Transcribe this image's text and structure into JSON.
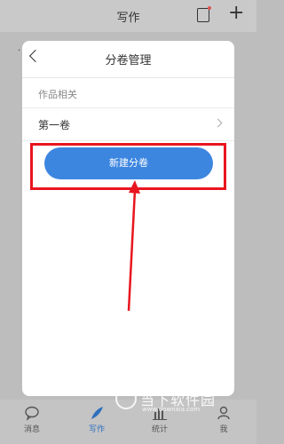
{
  "app": {
    "title": "写作"
  },
  "tabs": [
    {
      "label": "消息",
      "icon": "chat-icon"
    },
    {
      "label": "写作",
      "icon": "quill-icon"
    },
    {
      "label": "统计",
      "icon": "bar-chart-icon"
    },
    {
      "label": "我",
      "icon": "user-icon"
    }
  ],
  "modal": {
    "title": "分卷管理",
    "section_label": "作品相关",
    "volume_item": "第一卷",
    "new_button": "新建分卷"
  },
  "watermark": {
    "text": "当下软件园",
    "url": "www.downxia.com"
  },
  "colors": {
    "accent": "#3d86e0",
    "highlight": "#e8161f"
  }
}
